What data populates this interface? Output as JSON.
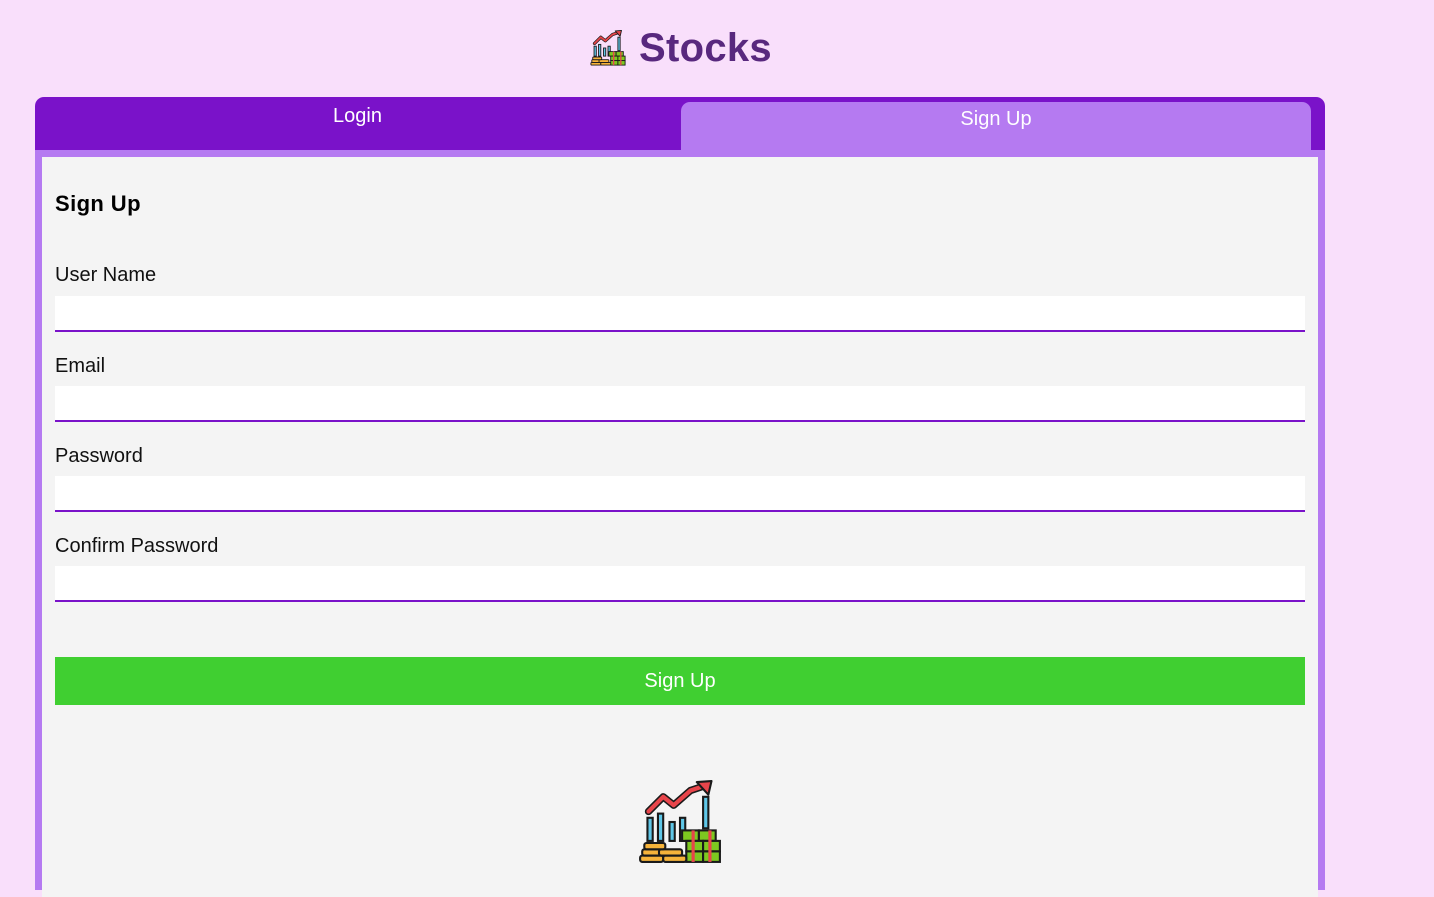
{
  "header": {
    "logo_icon": "stock-chart-money-icon",
    "title": "Stocks"
  },
  "tabs": [
    {
      "label": "Login",
      "active": false
    },
    {
      "label": "Sign Up",
      "active": true
    }
  ],
  "form": {
    "heading": "Sign Up",
    "fields": [
      {
        "label": "User Name",
        "value": "",
        "type": "text"
      },
      {
        "label": "Email",
        "value": "",
        "type": "email"
      },
      {
        "label": "Password",
        "value": "",
        "type": "password"
      },
      {
        "label": "Confirm Password",
        "value": "",
        "type": "password"
      }
    ],
    "submit_label": "Sign Up"
  },
  "footer": {
    "logo_icon": "stock-chart-money-icon"
  },
  "colors": {
    "page_background": "#f9dffb",
    "title": "#58287e",
    "tab_bar": "#7a12c9",
    "active_tab": "#b57af1",
    "panel_background": "#f4f4f4",
    "input_underline": "#7a12c9",
    "submit_button": "#40cf31"
  }
}
